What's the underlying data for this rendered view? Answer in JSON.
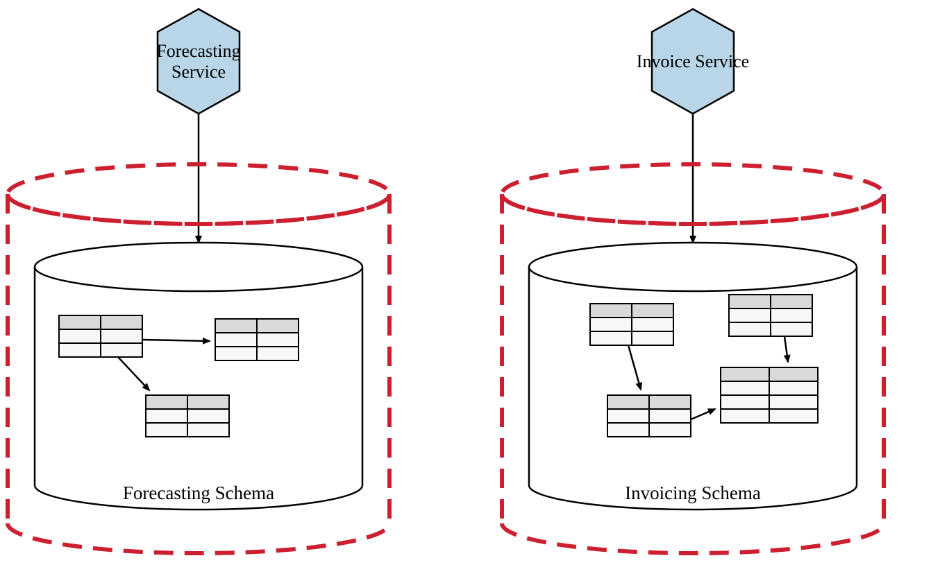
{
  "services": {
    "left": {
      "label_line1": "Forecasting",
      "label_line2": "Service"
    },
    "right": {
      "label_line1": "Invoice Service",
      "label_line2": ""
    }
  },
  "schemas": {
    "left": {
      "label": "Forecasting Schema"
    },
    "right": {
      "label": "Invoicing Schema"
    }
  },
  "colors": {
    "hexFill": "#b9d6e8",
    "dashedStroke": "#cc1f2f",
    "tableHeader": "#d9d9d9",
    "tableRow": "#f7f7f7",
    "black": "#000000"
  }
}
